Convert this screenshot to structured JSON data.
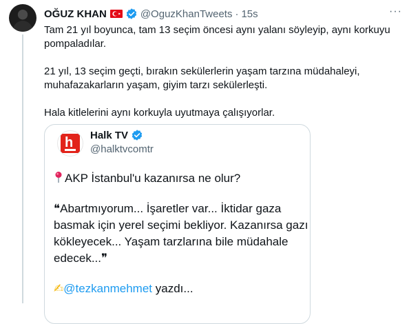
{
  "author": {
    "name": "OĞUZ KHAN",
    "handle": "@OguzKhanTweets",
    "time": "15s",
    "more_label": "···",
    "flag_icon": "turkish-flag-icon",
    "badge_icon": "verified-badge-icon"
  },
  "tweet": {
    "p1": "Tam 21 yıl boyunca, tam 13 seçim öncesi aynı yalanı söyleyip, aynı korkuyu pompaladılar.",
    "p2": "21 yıl, 13 seçim geçti, bırakın sekülerlerin yaşam tarzına müdahaleyi, muhafazakarların yaşam, giyim tarzı sekülerleşti.",
    "p3": "Hala kitlelerini aynı korkuyla uyutmaya çalışıyorlar."
  },
  "quote": {
    "name": "Halk TV",
    "handle": "@halktvcomtr",
    "line1": "AKP İstanbul'u kazanırsa ne olur?",
    "line2_open": "❝",
    "line2": "Abartmıyorum... İşaretler var... İktidar gaza basmak için yerel seçimi bekliyor. Kazanırsa gazı kökleyecek... Yaşam tarzlarına bile müdahale edecek...",
    "line2_close": "❞",
    "writing_emoji": "✍",
    "mention": "@tezkanmehmet",
    "line3_suffix": " yazdı..."
  },
  "colors": {
    "accent": "#1d9bf0",
    "flag": "#e30a17",
    "halk_red": "#e2231a",
    "muted": "#536471"
  }
}
